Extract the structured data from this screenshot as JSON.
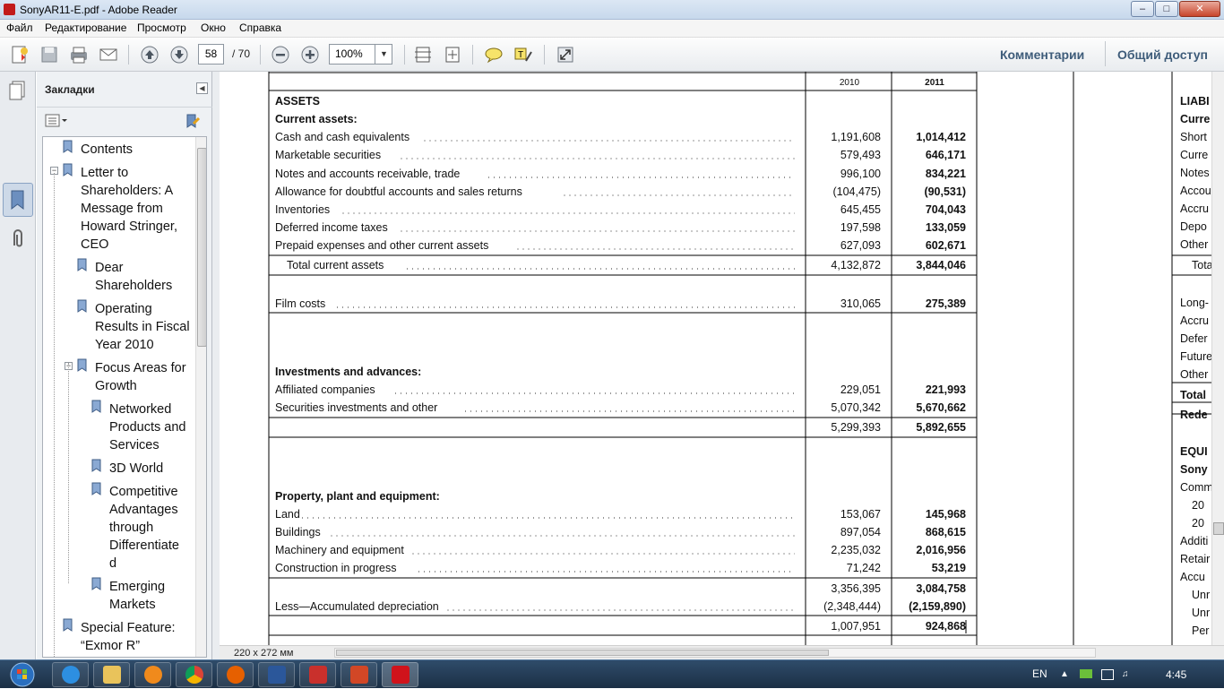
{
  "window": {
    "title": "SonyAR11-E.pdf - Adobe Reader"
  },
  "menu": [
    "Файл",
    "Редактирование",
    "Просмотр",
    "Окно",
    "Справка"
  ],
  "toolbar": {
    "page_current": "58",
    "page_total": "/ 70",
    "zoom": "100%",
    "comments": "Комментарии",
    "share": "Общий доступ"
  },
  "bookmarks": {
    "title": "Закладки",
    "items": [
      {
        "lines": [
          "Contents"
        ]
      },
      {
        "lines": [
          "Letter to",
          "Shareholders: A",
          "Message from",
          "Howard Stringer,",
          "CEO"
        ]
      },
      {
        "lines": [
          "Dear",
          "Shareholders"
        ]
      },
      {
        "lines": [
          "Operating",
          "Results in Fiscal",
          "Year 2010"
        ]
      },
      {
        "lines": [
          "Focus Areas for",
          "Growth"
        ]
      },
      {
        "lines": [
          "Networked",
          "Products and",
          "Services"
        ]
      },
      {
        "lines": [
          "3D World"
        ]
      },
      {
        "lines": [
          "Competitive",
          "Advantages",
          "through",
          "Differentiate",
          "d"
        ]
      },
      {
        "lines": [
          "Emerging",
          "Markets"
        ]
      },
      {
        "lines": [
          "Special Feature:",
          "“Exmor R”"
        ]
      }
    ]
  },
  "document": {
    "year_2010": "2010",
    "year_2011": "2011",
    "rows": [
      {
        "label": "ASSETS",
        "type": "head"
      },
      {
        "label": "Current assets:",
        "type": "head"
      },
      {
        "label": "Cash and cash equivalents",
        "v2010": "1,191,608",
        "v2011": "1,014,412"
      },
      {
        "label": "Marketable securities",
        "v2010": "579,493",
        "v2011": "646,171"
      },
      {
        "label": "Notes and accounts receivable, trade",
        "v2010": "996,100",
        "v2011": "834,221"
      },
      {
        "label": "Allowance for doubtful accounts and sales returns",
        "v2010": "(104,475)",
        "v2011": "(90,531)"
      },
      {
        "label": "Inventories",
        "v2010": "645,455",
        "v2011": "704,043"
      },
      {
        "label": "Deferred income taxes",
        "v2010": "197,598",
        "v2011": "133,059"
      },
      {
        "label": "Prepaid expenses and other current assets",
        "v2010": "627,093",
        "v2011": "602,671"
      },
      {
        "label": "Total current assets",
        "v2010": "4,132,872",
        "v2011": "3,844,046",
        "indent": true
      },
      {
        "label": "Film costs",
        "v2010": "310,065",
        "v2011": "275,389"
      },
      {
        "label": "Investments and advances:",
        "type": "head"
      },
      {
        "label": "Affiliated companies",
        "v2010": "229,051",
        "v2011": "221,993"
      },
      {
        "label": "Securities investments and other",
        "v2010": "5,070,342",
        "v2011": "5,670,662"
      },
      {
        "label": "",
        "v2010": "5,299,393",
        "v2011": "5,892,655"
      },
      {
        "label": "Property, plant and equipment:",
        "type": "head"
      },
      {
        "label": "Land",
        "v2010": "153,067",
        "v2011": "145,968"
      },
      {
        "label": "Buildings",
        "v2010": "897,054",
        "v2011": "868,615"
      },
      {
        "label": "Machinery and equipment",
        "v2010": "2,235,032",
        "v2011": "2,016,956"
      },
      {
        "label": "Construction in progress",
        "v2010": "71,242",
        "v2011": "53,219"
      },
      {
        "label": "",
        "v2010": "3,356,395",
        "v2011": "3,084,758"
      },
      {
        "label": "Less—Accumulated depreciation",
        "v2010": "(2,348,444)",
        "v2011": "(2,159,890)"
      },
      {
        "label": "",
        "v2010": "1,007,951",
        "v2011": "924,868"
      }
    ],
    "right_labels": [
      {
        "text": "LIABI",
        "bold": true
      },
      {
        "text": "Curre",
        "bold": true
      },
      {
        "text": "Short"
      },
      {
        "text": "Curre"
      },
      {
        "text": "Notes"
      },
      {
        "text": "Accou"
      },
      {
        "text": "Accru"
      },
      {
        "text": "Depo"
      },
      {
        "text": "Other"
      },
      {
        "text": "Tota"
      },
      {
        "text": "Long-"
      },
      {
        "text": "Accru"
      },
      {
        "text": "Defer"
      },
      {
        "text": "Future"
      },
      {
        "text": "Other"
      },
      {
        "text": "Total",
        "bold": true
      },
      {
        "text": "Rede",
        "bold": true
      },
      {
        "text": "EQUI",
        "bold": true
      },
      {
        "text": "Sony",
        "bold": true
      },
      {
        "text": "Comm"
      },
      {
        "text": "20"
      },
      {
        "text": "20"
      },
      {
        "text": "Additi"
      },
      {
        "text": "Retair"
      },
      {
        "text": "Accu"
      },
      {
        "text": "Unr"
      },
      {
        "text": "Unr"
      },
      {
        "text": "Per"
      }
    ]
  },
  "status": {
    "page_size": "220 x 272 мм"
  },
  "taskbar": {
    "lang": "EN",
    "time": "4:45"
  }
}
